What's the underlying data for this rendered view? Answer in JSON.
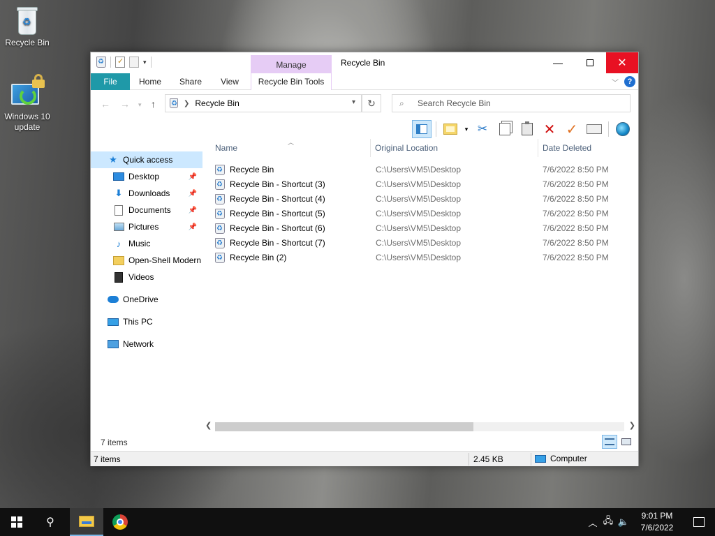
{
  "desktop": {
    "icons": [
      {
        "label": "Recycle Bin",
        "icon": "recycle-bin-icon"
      },
      {
        "label": "Windows 10 update",
        "icon": "windows-update-icon"
      }
    ]
  },
  "window": {
    "title": "Recycle Bin",
    "contextual_group": "Manage",
    "ribbon_tabs": {
      "file": "File",
      "home": "Home",
      "share": "Share",
      "view": "View",
      "tools": "Recycle Bin Tools"
    },
    "address": {
      "crumb": "Recycle Bin"
    },
    "search": {
      "placeholder": "Search Recycle Bin"
    },
    "toolbar_icons": [
      "preview-pane-icon",
      "new-folder-icon",
      "cut-icon",
      "copy-icon",
      "paste-icon",
      "delete-icon",
      "properties-check-icon",
      "rename-icon",
      "globe-icon"
    ],
    "nav": {
      "quick_access": "Quick access",
      "items": [
        {
          "label": "Desktop",
          "pinned": true
        },
        {
          "label": "Downloads",
          "pinned": true
        },
        {
          "label": "Documents",
          "pinned": true
        },
        {
          "label": "Pictures",
          "pinned": true
        },
        {
          "label": "Music",
          "pinned": false
        },
        {
          "label": "Open-Shell Modern",
          "pinned": false
        },
        {
          "label": "Videos",
          "pinned": false
        }
      ],
      "onedrive": "OneDrive",
      "this_pc": "This PC",
      "network": "Network"
    },
    "columns": {
      "name": "Name",
      "location": "Original Location",
      "date": "Date Deleted"
    },
    "files": [
      {
        "name": "Recycle Bin",
        "location": "C:\\Users\\VM5\\Desktop",
        "date": "7/6/2022 8:50 PM"
      },
      {
        "name": "Recycle Bin - Shortcut (3)",
        "location": "C:\\Users\\VM5\\Desktop",
        "date": "7/6/2022 8:50 PM"
      },
      {
        "name": "Recycle Bin - Shortcut (4)",
        "location": "C:\\Users\\VM5\\Desktop",
        "date": "7/6/2022 8:50 PM"
      },
      {
        "name": "Recycle Bin - Shortcut (5)",
        "location": "C:\\Users\\VM5\\Desktop",
        "date": "7/6/2022 8:50 PM"
      },
      {
        "name": "Recycle Bin - Shortcut (6)",
        "location": "C:\\Users\\VM5\\Desktop",
        "date": "7/6/2022 8:50 PM"
      },
      {
        "name": "Recycle Bin - Shortcut (7)",
        "location": "C:\\Users\\VM5\\Desktop",
        "date": "7/6/2022 8:50 PM"
      },
      {
        "name": "Recycle Bin (2)",
        "location": "C:\\Users\\VM5\\Desktop",
        "date": "7/6/2022 8:50 PM"
      }
    ],
    "info_count": "7 items",
    "status": {
      "count": "7 items",
      "size": "2.45 KB",
      "location": "Computer"
    }
  },
  "taskbar": {
    "clock_time": "9:01 PM",
    "clock_date": "7/6/2022"
  },
  "colors": {
    "file_tab": "#1f99a8",
    "manage_tab": "#e6ccf5",
    "close_button": "#e81123",
    "selection": "#cce8ff"
  }
}
